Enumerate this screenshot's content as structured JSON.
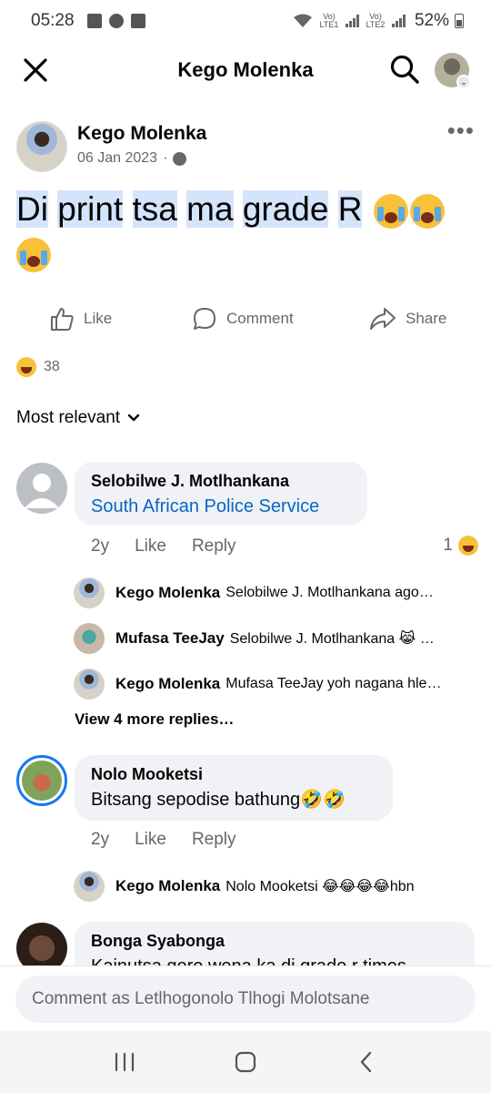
{
  "status_bar": {
    "time": "05:28",
    "battery": "52%",
    "lte1": "Vo) LTE1",
    "lte2": "Vo) LTE2"
  },
  "header": {
    "title": "Kego Molenka"
  },
  "post": {
    "author": "Kego Molenka",
    "date": "06 Jan 2023",
    "separator": "·",
    "text_words": [
      "Di",
      "print",
      "tsa",
      "ma",
      "grade",
      "R"
    ],
    "text_emojis": [
      "loudly-crying-face",
      "loudly-crying-face",
      "loudly-crying-face"
    ]
  },
  "actions": {
    "like": "Like",
    "comment": "Comment",
    "share": "Share"
  },
  "reactions": {
    "count": "38",
    "emoji": "laughing-face"
  },
  "sort": {
    "label": "Most relevant"
  },
  "comments": [
    {
      "name": "Selobilwe J. Motlhankana",
      "text": "South African Police Service",
      "age": "2y",
      "like": "Like",
      "reply": "Reply",
      "reaction_count": "1",
      "replies": [
        {
          "name": "Kego Molenka",
          "text": "Selobilwe J. Motlhankana ago…"
        },
        {
          "name": "Mufasa TeeJay",
          "text": "Selobilwe J. Motlhankana 😹 …"
        },
        {
          "name": "Kego Molenka",
          "text": "Mufasa TeeJay yoh nagana hle…"
        }
      ],
      "view_more": "View 4 more replies…"
    },
    {
      "name": "Nolo Mooketsi",
      "text": "Bitsang sepodise bathung🤣🤣",
      "age": "2y",
      "like": "Like",
      "reply": "Reply",
      "replies": [
        {
          "name": "Kego Molenka",
          "text": "Nolo Mooketsi 😂😂😂😂hbn"
        }
      ]
    },
    {
      "name": "Bonga Syabonga",
      "text": "Kainutsa gore wena ka di grade r times"
    }
  ],
  "comment_input": {
    "placeholder": "Comment as Letlhogonolo Tlhogi Molotsane"
  },
  "colors": {
    "link": "#0866c6",
    "muted": "#65676b",
    "bubble": "#f0f2f5",
    "highlight": "#d4e4fb",
    "story_ring": "#1877f2"
  }
}
